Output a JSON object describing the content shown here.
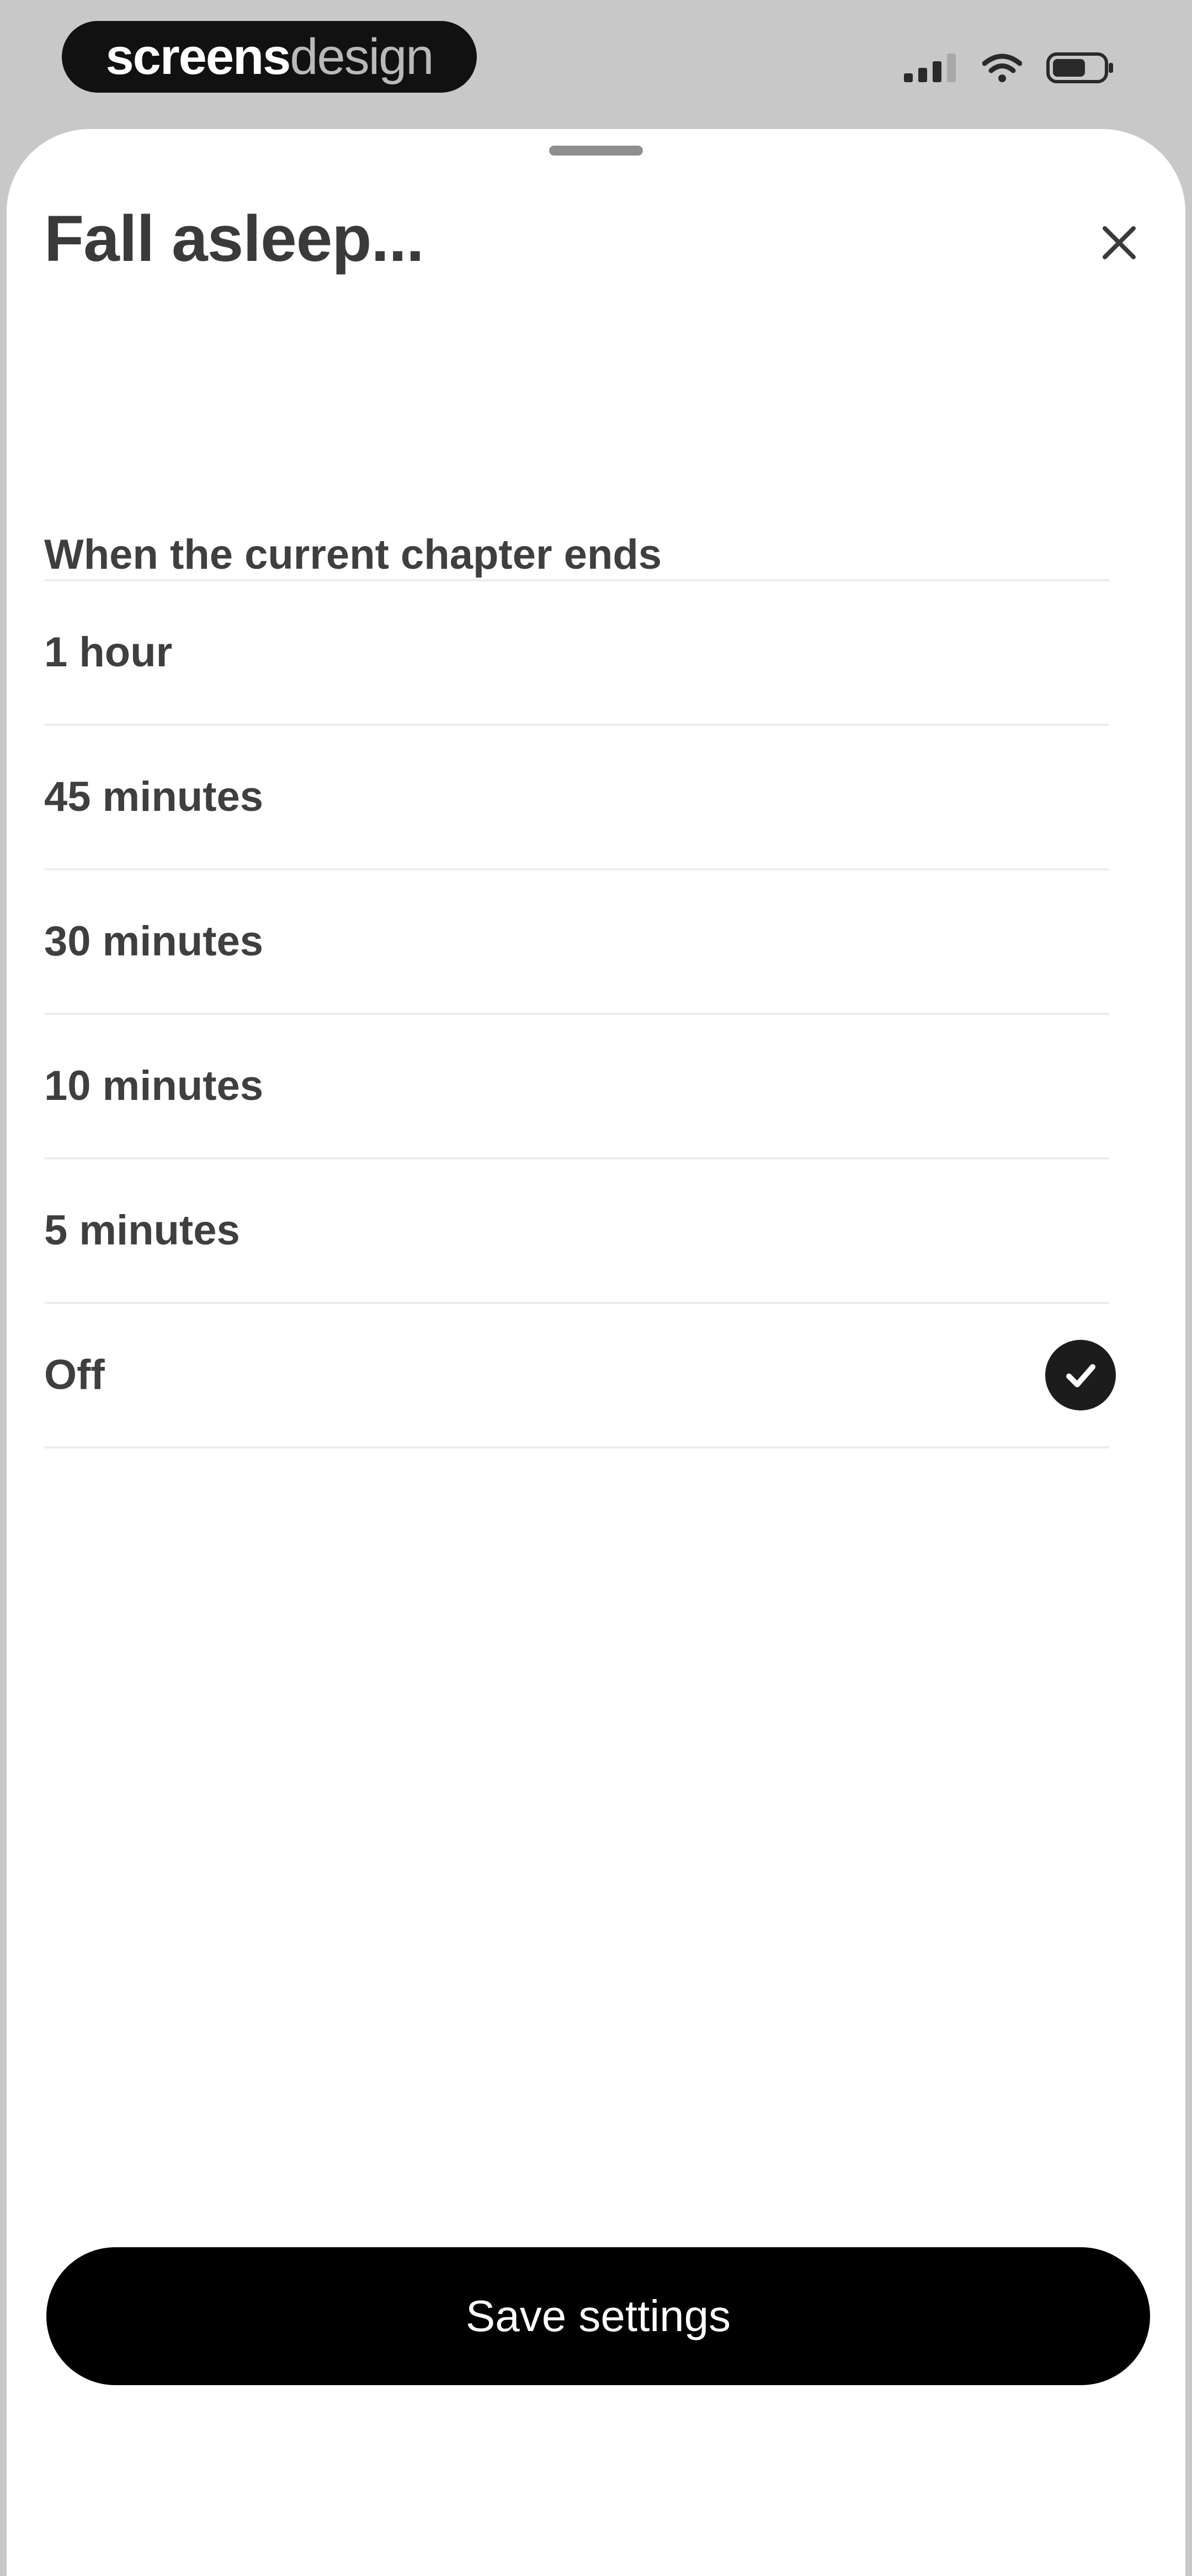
{
  "status_bar": {
    "brand_bold": "screens",
    "brand_light": "design",
    "icons": [
      "cellular-signal-icon",
      "wifi-icon",
      "battery-icon"
    ]
  },
  "sheet": {
    "title": "Fall asleep...",
    "close_icon": "close-icon",
    "options": [
      {
        "label": "When the current chapter ends",
        "selected": false
      },
      {
        "label": "1 hour",
        "selected": false
      },
      {
        "label": "45 minutes",
        "selected": false
      },
      {
        "label": "30 minutes",
        "selected": false
      },
      {
        "label": "10 minutes",
        "selected": false
      },
      {
        "label": "5 minutes",
        "selected": false
      },
      {
        "label": "Off",
        "selected": true
      }
    ],
    "selected_icon": "checkmark-circle-icon",
    "save_label": "Save settings"
  },
  "colors": {
    "background": "#c8c8c8",
    "sheet": "#ffffff",
    "text": "#3f3f3f",
    "accent": "#000000",
    "divider": "#ececec"
  }
}
